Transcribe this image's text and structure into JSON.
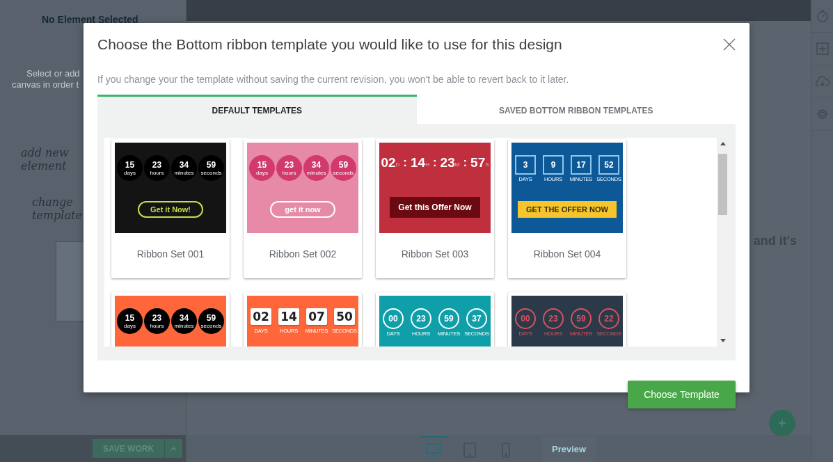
{
  "editor": {
    "sidebar_title": "No Element Selected",
    "sidebar_hint": [
      "Select or add",
      "canvas in order t"
    ],
    "sketch_notes": [
      "add new element",
      "change template"
    ],
    "canvas_text": "and it's",
    "save_button": "SAVE WORK",
    "device_tabs": [
      {
        "kind": "desktop",
        "selected": true
      },
      {
        "kind": "tablet",
        "selected": false
      },
      {
        "kind": "mobile",
        "selected": false
      }
    ],
    "preview_button": "Preview"
  },
  "dialog": {
    "title": "Choose the Bottom ribbon template you would like to use for this design",
    "notice": "If you change your the template without saving the current revision, you won't be able to revert back to it later.",
    "tabs": [
      {
        "label": "DEFAULT TEMPLATES",
        "selected": true
      },
      {
        "label": "SAVED BOTTOM RIBBON TEMPLATES",
        "selected": false
      }
    ],
    "templates": [
      {
        "name": "Ribbon Set 001",
        "kind": "dark-circles",
        "units": [
          {
            "value": "15",
            "label": "days"
          },
          {
            "value": "23",
            "label": "hours"
          },
          {
            "value": "34",
            "label": "minutes"
          },
          {
            "value": "59",
            "label": "seconds"
          }
        ],
        "button": "Get it Now!"
      },
      {
        "name": "Ribbon Set 002",
        "kind": "pink-circles",
        "units": [
          {
            "value": "15",
            "label": "days"
          },
          {
            "value": "23",
            "label": "hours"
          },
          {
            "value": "34",
            "label": "minutes"
          },
          {
            "value": "59",
            "label": "seconds"
          }
        ],
        "button": "get it now"
      },
      {
        "name": "Ribbon Set 003",
        "kind": "red-colon",
        "separator": ":",
        "units": [
          {
            "value": "02",
            "label": "D"
          },
          {
            "value": "14",
            "label": "H"
          },
          {
            "value": "23",
            "label": "M"
          },
          {
            "value": "57",
            "label": "S"
          }
        ],
        "button": "Get this Offer Now"
      },
      {
        "name": "Ribbon Set 004",
        "kind": "blue-boxes",
        "units": [
          {
            "value": "3",
            "label": "DAYS"
          },
          {
            "value": "9",
            "label": "HOURS"
          },
          {
            "value": "17",
            "label": "MINUTES"
          },
          {
            "value": "52",
            "label": "SECONDS"
          }
        ],
        "button": "GET THE OFFER NOW"
      },
      {
        "kind": "orange-circles",
        "units": [
          {
            "value": "15",
            "label": "days"
          },
          {
            "value": "23",
            "label": "hours"
          },
          {
            "value": "34",
            "label": "minutes"
          },
          {
            "value": "59",
            "label": "seconds"
          }
        ]
      },
      {
        "kind": "orange-flip",
        "units": [
          {
            "value": "02",
            "label": "DAYS"
          },
          {
            "value": "14",
            "label": "HOURS"
          },
          {
            "value": "07",
            "label": "MINUTES"
          },
          {
            "value": "50",
            "label": "SECONDS"
          }
        ]
      },
      {
        "kind": "teal-rings",
        "units": [
          {
            "value": "00",
            "label": "DAYS"
          },
          {
            "value": "23",
            "label": "HOURS"
          },
          {
            "value": "59",
            "label": "MINUTES"
          },
          {
            "value": "37",
            "label": "SECONDS"
          }
        ]
      },
      {
        "kind": "navy-rings",
        "units": [
          {
            "value": "00",
            "label": "DAYS"
          },
          {
            "value": "23",
            "label": "HOURS"
          },
          {
            "value": "59",
            "label": "MINUTES"
          },
          {
            "value": "22",
            "label": "SECONDS"
          }
        ]
      }
    ],
    "primary_button": "Choose Template"
  }
}
